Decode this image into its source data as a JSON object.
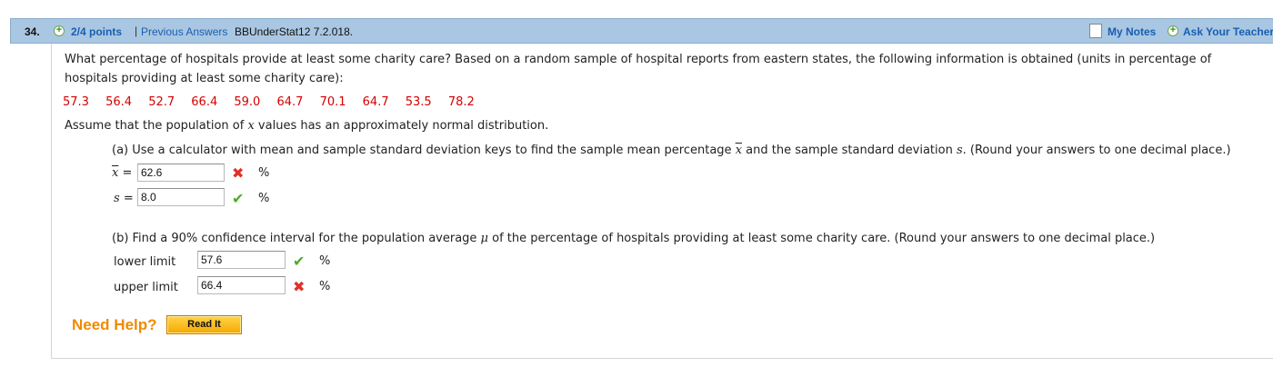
{
  "header": {
    "question_number": "34.",
    "points": "2/4 points",
    "separator": "|",
    "previous_answers": "Previous Answers",
    "source": "BBUnderStat12 7.2.018.",
    "my_notes": "My Notes",
    "ask_teacher": "Ask Your Teacher",
    "plus_glyph": "+"
  },
  "question": {
    "line1": "What percentage of hospitals provide at least some charity care? Based on a random sample of hospital reports from eastern states, the following information is obtained (units in percentage of",
    "line2": "hospitals providing at least some charity care):",
    "data": [
      "57.3",
      "56.4",
      "52.7",
      "66.4",
      "59.0",
      "64.7",
      "70.1",
      "64.7",
      "53.5",
      "78.2"
    ],
    "assume_pre": "Assume that the population of ",
    "assume_var": "x",
    "assume_post": " values has an approximately normal distribution."
  },
  "part_a": {
    "text_pre": "(a) Use a calculator with mean and sample standard deviation keys to find the sample mean percentage ",
    "text_xbar": "x",
    "text_mid": " and the sample standard deviation ",
    "text_s": "s",
    "text_post": ". (Round your answers to one decimal place.)",
    "xbar_label": "x",
    "equals": "=",
    "xbar_value": "62.6",
    "s_label": "s",
    "s_value": "8.0",
    "unit": "%"
  },
  "part_b": {
    "text_pre": "(b) Find a 90% confidence interval for the population average ",
    "text_mu": "μ",
    "text_post": " of the percentage of hospitals providing at least some charity care. (Round your answers to one decimal place.)",
    "lower_label": "lower limit",
    "lower_value": "57.6",
    "upper_label": "upper limit",
    "upper_value": "66.4",
    "unit": "%"
  },
  "marks": {
    "wrong": "✖",
    "correct": "✔"
  },
  "help": {
    "need_help": "Need Help?",
    "read_it": "Read It"
  },
  "colors": {
    "header_bg": "#a9c7e2",
    "link": "#1a5eb0",
    "data_red": "#d40000",
    "help_orange": "#f08a00",
    "correct_green": "#4caa2a",
    "wrong_red": "#e0302a"
  }
}
